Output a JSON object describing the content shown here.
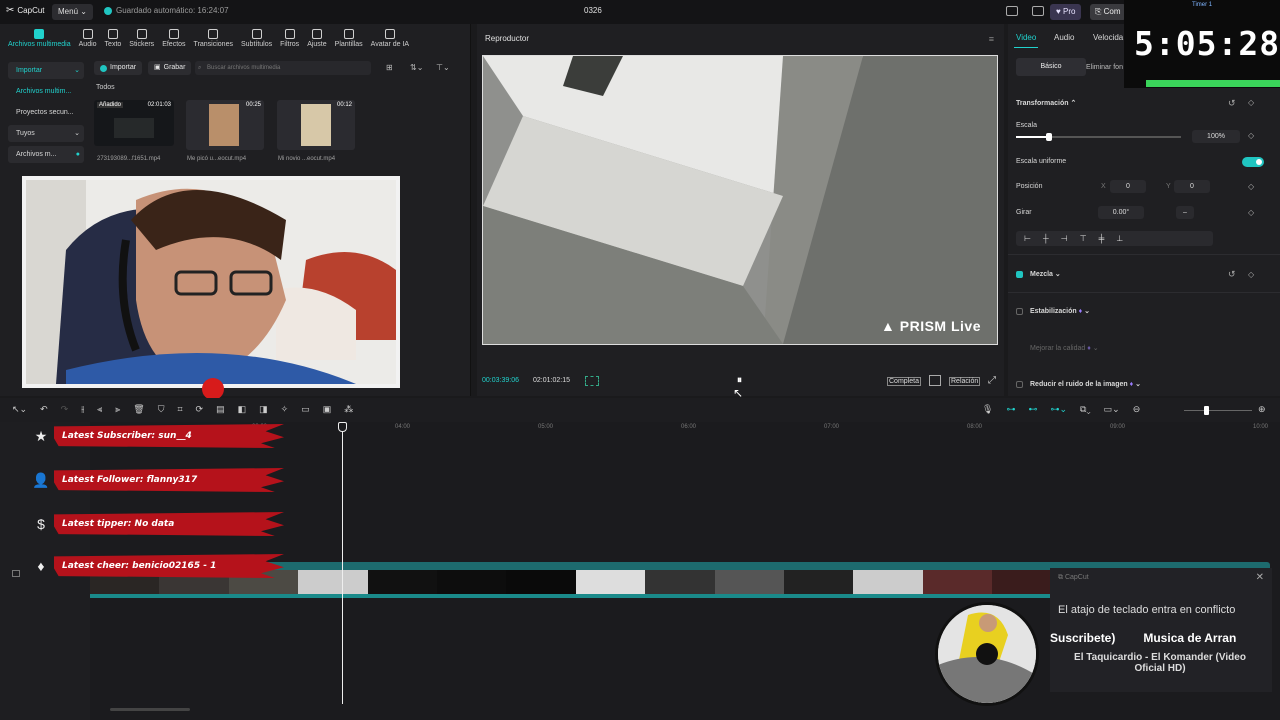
{
  "topbar": {
    "logo": "CapCut",
    "menu": "Menú",
    "autosave": "Guardado automático: 16:24:07",
    "project_title": "0326",
    "pro": "Pro",
    "comp": "Com"
  },
  "timer": {
    "label": "Timer 1",
    "time": "5:05:28"
  },
  "media_toolbar": [
    "Archivos multimedia",
    "Audio",
    "Texto",
    "Stickers",
    "Efectos",
    "Transiciones",
    "Subtítulos",
    "Filtros",
    "Ajuste",
    "Plantillas",
    "Avatar de IA"
  ],
  "media_sidebar": {
    "import": "Importar",
    "items": [
      "Archivos multim...",
      "Proyectos secun...",
      "Tuyos",
      "Archivos m..."
    ]
  },
  "media_actions": {
    "import": "Importar",
    "record": "Grabar",
    "search_placeholder": "Buscar archivos multimedia",
    "all": "Todos"
  },
  "media_items": [
    {
      "badge": "Añadido",
      "duration": "02:01:03",
      "caption": "273193089...f1651.mp4"
    },
    {
      "duration": "00:25",
      "caption": "Me picó u...eocut.mp4"
    },
    {
      "duration": "00:12",
      "caption": "Mi novio ...eocut.mp4"
    }
  ],
  "player": {
    "title": "Reproductor",
    "watermark": "PRISM Live",
    "current_time": "00:03:39:06",
    "total_time": "02:01:02:15",
    "full": "Completa",
    "ratio": "Relación"
  },
  "props": {
    "tabs": [
      "Video",
      "Audio",
      "Velocida"
    ],
    "subtabs": [
      "Básico",
      "Eliminar fon"
    ],
    "transform": "Transformación",
    "scale_label": "Escala",
    "scale_value": "100%",
    "scale_fraction": 0.2,
    "uniform_scale": "Escala uniforme",
    "position": "Posición",
    "x_label": "X",
    "x_value": "0",
    "y_label": "Y",
    "y_value": "0",
    "rotate": "Girar",
    "rotate_value": "0.00°",
    "blend": "Mezcla",
    "stabilize": "Estabilización",
    "improve_quality": "Mejorar la calidad",
    "reduce_noise": "Reducir el ruido de la imagen"
  },
  "ruler": [
    "03:00",
    "04:00",
    "05:00",
    "06:00",
    "07:00",
    "08:00",
    "09:00",
    "10:00"
  ],
  "alerts": [
    {
      "icon": "★",
      "text": "Latest Subscriber: sun__4"
    },
    {
      "icon": "👤",
      "text": "Latest Follower: flanny317"
    },
    {
      "icon": "$",
      "text": "Latest tipper: No data"
    },
    {
      "icon": "♦",
      "text": "Latest cheer: benicio02165 - 1"
    }
  ],
  "notification": {
    "app": "CapCut",
    "message": "El atajo de teclado entra en conflicto"
  },
  "music": {
    "ticker_left": "Suscribete)",
    "ticker_right": "Musica de Arran",
    "song": "El Taquicardio - El Komander (Video Oficial HD)"
  }
}
